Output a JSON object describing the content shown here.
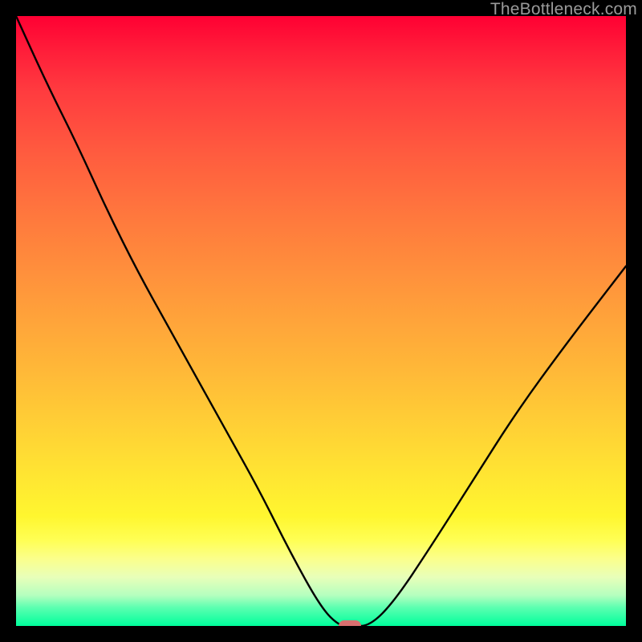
{
  "watermark": {
    "text": "TheBottleneck.com"
  },
  "marker": {
    "x_frac": 0.548,
    "bottom_frac": 0.0,
    "color": "#d96f6f"
  },
  "chart_data": {
    "type": "line",
    "title": "",
    "xlabel": "",
    "ylabel": "",
    "xlim": [
      0,
      1
    ],
    "ylim": [
      0,
      1
    ],
    "grid": false,
    "legend": false,
    "x_note": "x is fraction across the plot width (0 = left edge, 1 = right edge)",
    "y_note": "y is fraction from bottom (0 = bottom / green, 1 = top / red); values estimated from pixels",
    "series": [
      {
        "name": "bottleneck-curve",
        "x": [
          0.0,
          0.05,
          0.1,
          0.15,
          0.2,
          0.25,
          0.3,
          0.35,
          0.4,
          0.45,
          0.5,
          0.53,
          0.55,
          0.58,
          0.62,
          0.68,
          0.75,
          0.82,
          0.9,
          1.0
        ],
        "y": [
          1.0,
          0.89,
          0.79,
          0.68,
          0.58,
          0.49,
          0.4,
          0.31,
          0.22,
          0.12,
          0.03,
          0.0,
          0.0,
          0.0,
          0.04,
          0.13,
          0.24,
          0.35,
          0.46,
          0.59
        ]
      }
    ],
    "background_gradient": {
      "orientation": "vertical",
      "stops": [
        {
          "pos": 0.0,
          "color": "#ff0033"
        },
        {
          "pos": 0.22,
          "color": "#ff5a3f"
        },
        {
          "pos": 0.46,
          "color": "#ff9a3b"
        },
        {
          "pos": 0.76,
          "color": "#ffe732"
        },
        {
          "pos": 0.92,
          "color": "#e8ffb9"
        },
        {
          "pos": 1.0,
          "color": "#00ff9c"
        }
      ]
    },
    "marker": {
      "x": 0.548,
      "y": 0.0,
      "shape": "pill",
      "color": "#d96f6f"
    }
  }
}
